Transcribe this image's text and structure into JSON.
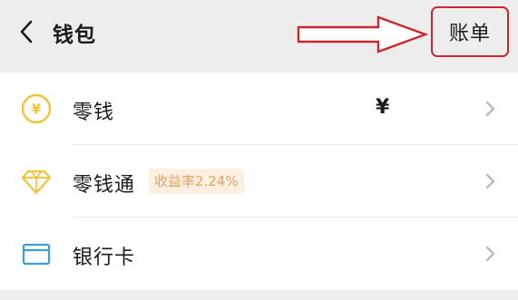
{
  "header": {
    "back_icon": "chevron-left-icon",
    "title": "钱包",
    "bill_label": "账单"
  },
  "list": {
    "items": [
      {
        "icon": "yuan-coin-icon",
        "label": "零钱",
        "amount": "¥",
        "chevron": "chevron-right-icon"
      },
      {
        "icon": "diamond-icon",
        "label": "零钱通",
        "badge": "收益率2.24%",
        "chevron": "chevron-right-icon"
      },
      {
        "icon": "bank-card-icon",
        "label": "银行卡",
        "chevron": "chevron-right-icon"
      }
    ]
  },
  "annotation": {
    "arrow_color": "#c62a2f",
    "frame_color": "#c62a2f"
  },
  "colors": {
    "coin": "#f1c232",
    "diamond": "#f3c53d",
    "card": "#3a9fd5",
    "badge_bg": "#fdf0e3",
    "badge_text": "#e7a25b"
  }
}
